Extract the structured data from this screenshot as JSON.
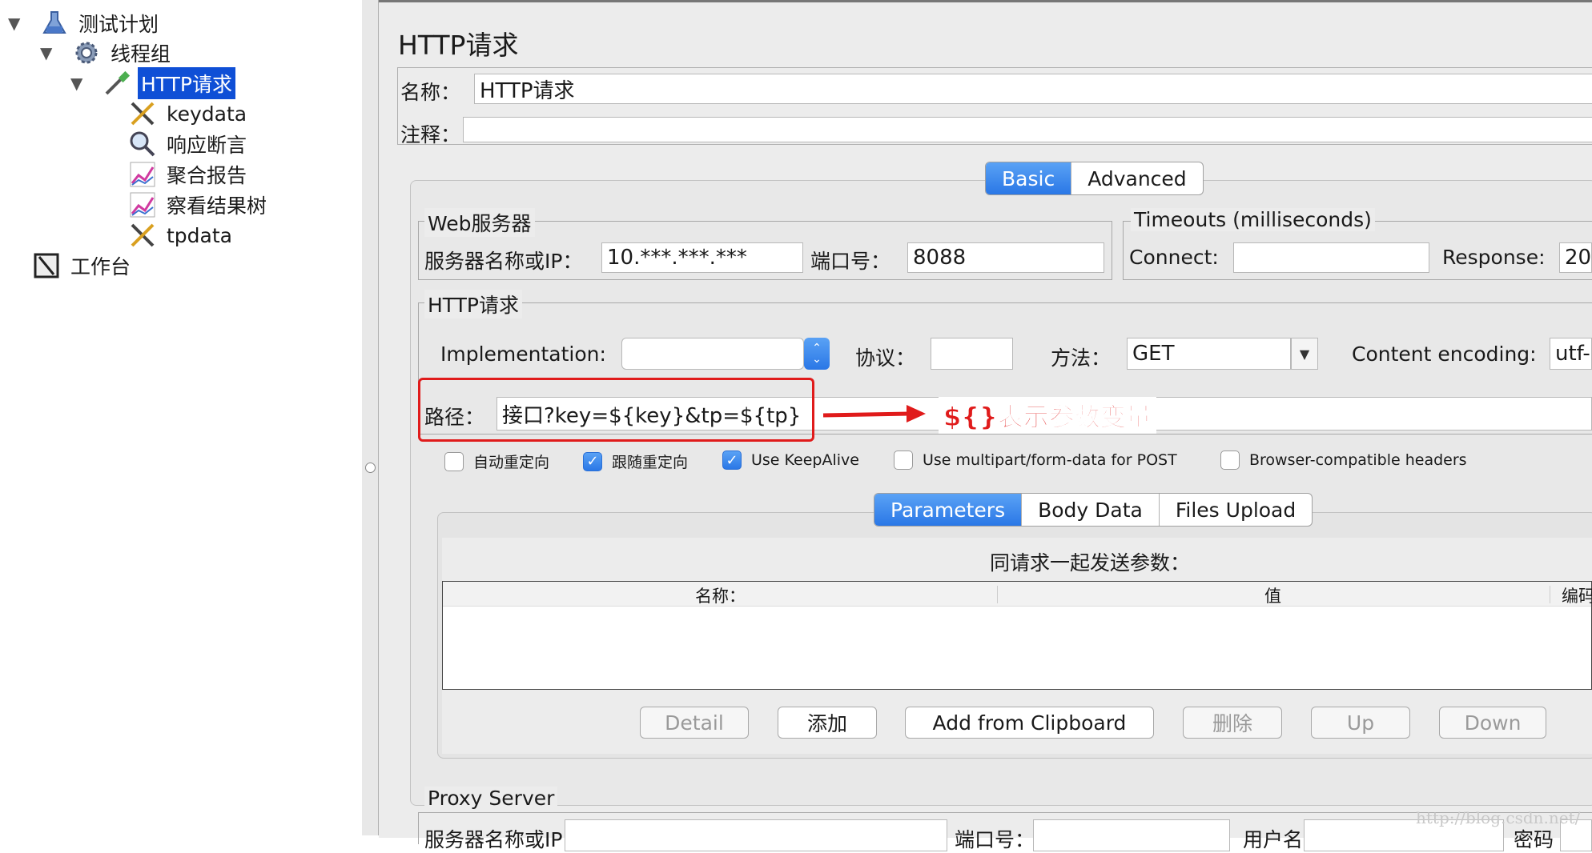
{
  "tree": {
    "items": [
      {
        "label": "测试计划",
        "icon": "flask-icon"
      },
      {
        "label": "线程组",
        "icon": "gear-icon"
      },
      {
        "label": "HTTP请求",
        "icon": "pipette-icon"
      },
      {
        "label": "keydata",
        "icon": "tools-icon"
      },
      {
        "label": "响应断言",
        "icon": "magnifier-icon"
      },
      {
        "label": "聚合报告",
        "icon": "chart-icon"
      },
      {
        "label": "察看结果树",
        "icon": "chart-icon"
      },
      {
        "label": "tpdata",
        "icon": "tools-icon"
      },
      {
        "label": "工作台",
        "icon": "workbench-icon"
      }
    ]
  },
  "panel": {
    "title": "HTTP请求",
    "name_label": "名称：",
    "name_value": "HTTP请求",
    "comment_label": "注释：",
    "comment_value": ""
  },
  "tabs": {
    "basic": "Basic",
    "advanced": "Advanced"
  },
  "web_server": {
    "group_title": "Web服务器",
    "server_label": "服务器名称或IP：",
    "server_value": "10.***.***.***",
    "port_label": "端口号：",
    "port_value": "8088"
  },
  "timeouts": {
    "group_title": "Timeouts (milliseconds)",
    "connect_label": "Connect:",
    "connect_value": "",
    "response_label": "Response:",
    "response_value": "20"
  },
  "http_request": {
    "group_title": "HTTP请求",
    "impl_label": "Implementation:",
    "impl_value": "",
    "protocol_label": "协议：",
    "protocol_value": "",
    "method_label": "方法：",
    "method_value": "GET",
    "encoding_label": "Content encoding:",
    "encoding_value": "utf-",
    "path_label": "路径：",
    "path_value": "接口?key=${key}&tp=${tp}",
    "annotation": "${}表示参数变量"
  },
  "checkboxes": [
    {
      "label": "自动重定向",
      "checked": false
    },
    {
      "label": "跟随重定向",
      "checked": true
    },
    {
      "label": "Use KeepAlive",
      "checked": true
    },
    {
      "label": "Use multipart/form-data for POST",
      "checked": false
    },
    {
      "label": "Browser-compatible headers",
      "checked": false
    }
  ],
  "param_tabs": {
    "parameters": "Parameters",
    "body": "Body Data",
    "files": "Files Upload"
  },
  "params": {
    "caption": "同请求一起发送参数：",
    "col_name": "名称：",
    "col_value": "值",
    "col_encode": "编码"
  },
  "buttons": {
    "detail": "Detail",
    "add": "添加",
    "clipboard": "Add from Clipboard",
    "delete": "删除",
    "up": "Up",
    "down": "Down"
  },
  "proxy": {
    "group_title": "Proxy Server",
    "server_label": "服务器名称或IP：",
    "port_label": "端口号：",
    "user_label": "用户名",
    "pass_label": "密码"
  },
  "watermark": "http://blog.csdn.net/",
  "colors": {
    "selection": "#0f4fd6",
    "accent": "#2a77e6",
    "annotation": "#e01b1b"
  }
}
